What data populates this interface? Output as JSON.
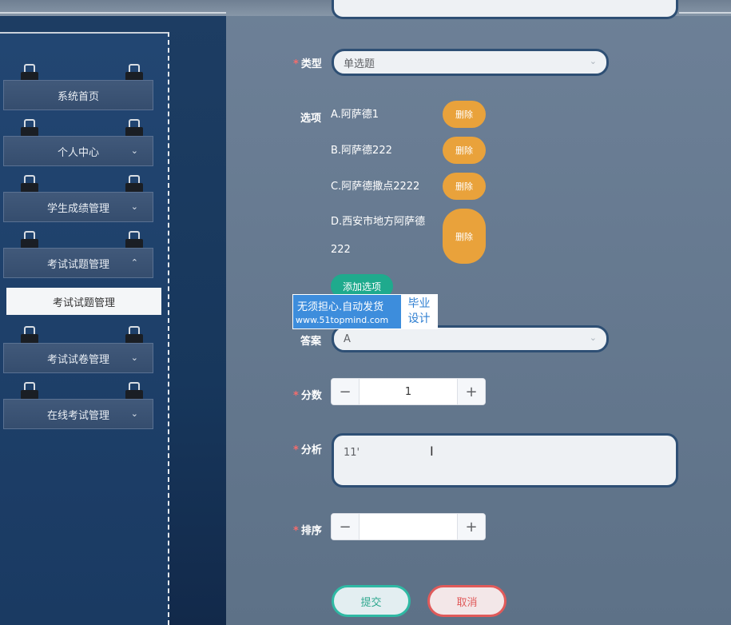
{
  "sidebar": {
    "items": [
      {
        "label": "系统首页",
        "arrow": ""
      },
      {
        "label": "个人中心",
        "arrow": "⌄"
      },
      {
        "label": "学生成绩管理",
        "arrow": "⌄"
      },
      {
        "label": "考试试题管理",
        "arrow": "⌃"
      },
      {
        "label": "考试试卷管理",
        "arrow": "⌄"
      },
      {
        "label": "在线考试管理",
        "arrow": "⌄"
      }
    ],
    "active_sub": "考试试题管理"
  },
  "form": {
    "type_label": "类型",
    "type_value": "单选题",
    "options_label": "选项",
    "options": [
      {
        "text": "A.阿萨德1",
        "delete_label": "删除"
      },
      {
        "text": "B.阿萨德222",
        "delete_label": "删除"
      },
      {
        "text": "C.阿萨德撒点2222",
        "delete_label": "删除"
      },
      {
        "text_line1": "D.西安市地方阿萨德",
        "text_line2": "222",
        "delete_label": "删除"
      }
    ],
    "add_option_label": "添加选项",
    "answer_label": "答案",
    "answer_value": "A",
    "score_label": "分数",
    "score_value": "1",
    "analysis_label": "分析",
    "analysis_value": "11'",
    "sort_label": "排序",
    "sort_value": "",
    "required_mark": "*",
    "submit_label": "提交",
    "cancel_label": "取消"
  },
  "watermark": {
    "line1": "无须担心.自动发货",
    "line2": "www.51topmind.com",
    "right_line1": "毕业",
    "right_line2": "设计"
  },
  "icons": {
    "minus": "−",
    "plus": "+",
    "chevron": "⌄",
    "text_cursor": "I"
  },
  "colors": {
    "delete_button": "#e9a23b",
    "add_button": "#1faa8d",
    "submit_border": "#2fb9a4",
    "cancel_border": "#e05a5a",
    "required": "#f56c6c"
  }
}
